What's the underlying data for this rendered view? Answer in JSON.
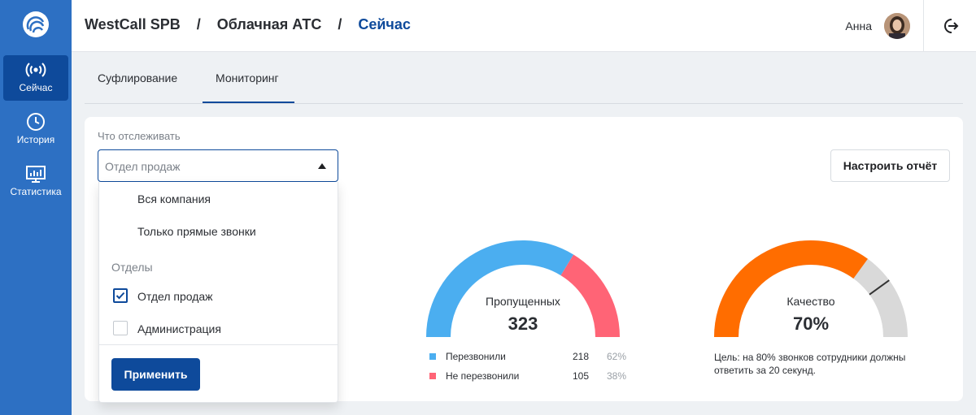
{
  "sidebar": {
    "items": [
      {
        "label": "Сейчас",
        "icon": "broadcast-icon",
        "active": true
      },
      {
        "label": "История",
        "icon": "clock-icon",
        "active": false
      },
      {
        "label": "Статистика",
        "icon": "chart-icon",
        "active": false
      }
    ]
  },
  "header": {
    "breadcrumb": [
      "WestCall SPB",
      "Облачная АТС",
      "Сейчас"
    ],
    "separator": "/",
    "user_name": "Анна"
  },
  "tabs": [
    {
      "label": "Суфлирование",
      "active": false
    },
    {
      "label": "Мониторинг",
      "active": true
    }
  ],
  "filter": {
    "label": "Что отслеживать",
    "selected": "Отдел продаж",
    "options": [
      {
        "label": "Вся компания"
      },
      {
        "label": "Только прямые звонки"
      }
    ],
    "section_label": "Отделы",
    "departments": [
      {
        "label": "Отдел продаж",
        "checked": true
      },
      {
        "label": "Администрация",
        "checked": false
      }
    ],
    "apply_label": "Применить"
  },
  "report_button_label": "Настроить отчёт",
  "missed_gauge": {
    "title": "Пропущенных",
    "total": "323",
    "segments": [
      {
        "name": "Перезвонили",
        "value": 218,
        "percent": "62%",
        "color": "#4baef0"
      },
      {
        "name": "Не перезвонили",
        "value": 105,
        "percent": "38%",
        "color": "#ff6476"
      }
    ]
  },
  "quality_gauge": {
    "title": "Качество",
    "value_label": "70%",
    "value": 70,
    "target": 80,
    "color": "#ff6d00",
    "track_color": "#d9d9d9",
    "goal": "Цель: на 80% звонков сотрудники должны ответить за 20 секунд."
  },
  "colors": {
    "sidebar": "#2d70c3",
    "accent": "#0e4a9b"
  }
}
